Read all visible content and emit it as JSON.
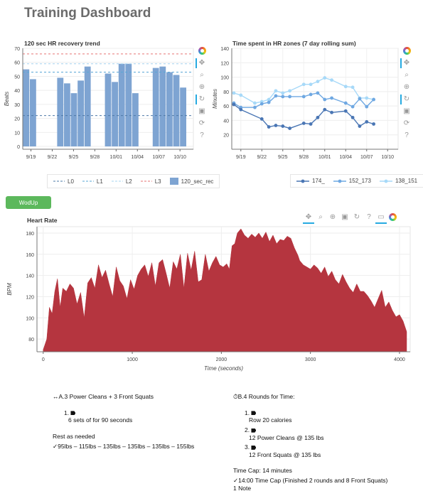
{
  "page": {
    "title": "Training Dashboard"
  },
  "charts_meta": {
    "hr_recovery": {
      "title": "120 sec HR recovery trend",
      "ylabel": "Beats"
    },
    "hr_zones": {
      "title": "Time spent in HR zones (7 day rolling sum)",
      "ylabel": "Minutes"
    },
    "heart_rate": {
      "title": "Heart Rate",
      "ylabel": "BPM",
      "xlabel": "Time (seconds)"
    }
  },
  "button": {
    "label": "WodUp"
  },
  "workout_a": {
    "header": "A.3 Power Cleans + 3 Front Squats",
    "items": [
      {
        "num": "1.",
        "text": "6 sets of for 90 seconds"
      }
    ],
    "rest": "Rest as needed",
    "result": "95lbs – 115lbs – 135lbs – 135lbs – 135lbs – 155lbs"
  },
  "workout_b": {
    "header": "B.4 Rounds for Time:",
    "items": [
      {
        "num": "1.",
        "text": "Row 20 calories"
      },
      {
        "num": "2.",
        "text": "12 Power Cleans @ 135 lbs"
      },
      {
        "num": "3.",
        "text": "12 Front Squats @ 135 lbs"
      }
    ],
    "time_cap": "Time Cap: 14 minutes",
    "result": "14:00 Time Cap (Finished 2 rounds and 8 Front Squats)",
    "note": "1 Note"
  },
  "chart_data": [
    {
      "type": "bar",
      "title": "120 sec HR recovery trend",
      "ylabel": "Beats",
      "x_ticks": [
        "9/19",
        "9/22",
        "9/25",
        "9/28",
        "10/01",
        "10/04",
        "10/07",
        "10/10"
      ],
      "ylim": [
        -2,
        70
      ],
      "y_ticks": [
        0,
        10,
        20,
        30,
        40,
        50,
        60,
        70
      ],
      "x_start_day": 0,
      "x_end_day": 24,
      "bars": [
        {
          "day": 0,
          "value": 55
        },
        {
          "day": 1,
          "value": 48
        },
        {
          "day": 5,
          "value": 49
        },
        {
          "day": 6,
          "value": 45
        },
        {
          "day": 7,
          "value": 38
        },
        {
          "day": 8,
          "value": 47
        },
        {
          "day": 9,
          "value": 57
        },
        {
          "day": 12,
          "value": 52
        },
        {
          "day": 13,
          "value": 46
        },
        {
          "day": 14,
          "value": 59
        },
        {
          "day": 15,
          "value": 59
        },
        {
          "day": 16,
          "value": 38
        },
        {
          "day": 19,
          "value": 56
        },
        {
          "day": 20,
          "value": 57
        },
        {
          "day": 21,
          "value": 53
        },
        {
          "day": 22,
          "value": 51
        },
        {
          "day": 23,
          "value": 42
        }
      ],
      "lines": [
        {
          "name": "L0",
          "value": 22,
          "color": "#4e79a7"
        },
        {
          "name": "L1",
          "value": 53,
          "color": "#5aa7d6"
        },
        {
          "name": "L2",
          "value": 59,
          "color": "#a5d4f0"
        },
        {
          "name": "L3",
          "value": 66,
          "color": "#e77373"
        }
      ],
      "bar_series": {
        "name": "120_sec_rec",
        "color": "#7ea4d2"
      }
    },
    {
      "type": "line",
      "title": "Time spent in HR zones (7 day rolling sum)",
      "ylabel": "Minutes",
      "x_ticks": [
        "9/19",
        "9/22",
        "9/25",
        "9/28",
        "10/01",
        "10/04",
        "10/07",
        "10/10"
      ],
      "ylim": [
        0,
        140
      ],
      "y_ticks": [
        20,
        40,
        60,
        80,
        100,
        120,
        140
      ],
      "series": [
        {
          "name": "174_",
          "color": "#4a76b4",
          "points": [
            [
              -1,
              62
            ],
            [
              0,
              55
            ],
            [
              3,
              42
            ],
            [
              4,
              31
            ],
            [
              5,
              33
            ],
            [
              6,
              32
            ],
            [
              7,
              29
            ],
            [
              9,
              36
            ],
            [
              10,
              35
            ],
            [
              11,
              44
            ],
            [
              12,
              55
            ],
            [
              13,
              51
            ],
            [
              15,
              53
            ],
            [
              16,
              44
            ],
            [
              17,
              32
            ],
            [
              18,
              38
            ],
            [
              19,
              35
            ]
          ]
        },
        {
          "name": "152_173",
          "color": "#6fa8e2",
          "points": [
            [
              -1,
              64
            ],
            [
              0,
              58
            ],
            [
              2,
              58
            ],
            [
              3,
              63
            ],
            [
              4,
              65
            ],
            [
              5,
              74
            ],
            [
              6,
              73
            ],
            [
              7,
              73
            ],
            [
              9,
              73
            ],
            [
              10,
              76
            ],
            [
              11,
              78
            ],
            [
              12,
              69
            ],
            [
              13,
              71
            ],
            [
              15,
              64
            ],
            [
              16,
              59
            ],
            [
              17,
              70
            ],
            [
              18,
              59
            ],
            [
              19,
              69
            ]
          ]
        },
        {
          "name": "138_151",
          "color": "#a7d9f8",
          "points": [
            [
              -1,
              78
            ],
            [
              0,
              75
            ],
            [
              2,
              64
            ],
            [
              3,
              66
            ],
            [
              4,
              69
            ],
            [
              5,
              81
            ],
            [
              6,
              78
            ],
            [
              7,
              81
            ],
            [
              9,
              90
            ],
            [
              10,
              90
            ],
            [
              11,
              94
            ],
            [
              12,
              99
            ],
            [
              13,
              96
            ],
            [
              15,
              87
            ],
            [
              16,
              86
            ],
            [
              17,
              71
            ],
            [
              18,
              71
            ],
            [
              19,
              69
            ]
          ]
        }
      ]
    },
    {
      "type": "area",
      "title": "Heart Rate",
      "xlabel": "Time (seconds)",
      "ylabel": "BPM",
      "xlim": [
        -70,
        4120
      ],
      "ylim": [
        68,
        186
      ],
      "x_ticks": [
        0,
        1000,
        2000,
        3000,
        4000
      ],
      "y_ticks": [
        80,
        100,
        120,
        140,
        160,
        180
      ],
      "color": "#b5353f",
      "x": [
        0,
        40,
        70,
        100,
        130,
        160,
        190,
        220,
        260,
        300,
        340,
        380,
        420,
        460,
        500,
        540,
        580,
        620,
        660,
        700,
        740,
        780,
        820,
        860,
        900,
        940,
        980,
        1020,
        1060,
        1100,
        1140,
        1180,
        1220,
        1260,
        1300,
        1340,
        1380,
        1420,
        1460,
        1500,
        1540,
        1580,
        1620,
        1660,
        1700,
        1740,
        1780,
        1820,
        1860,
        1900,
        1940,
        1980,
        2020,
        2060,
        2090,
        2120,
        2150,
        2180,
        2220,
        2260,
        2300,
        2340,
        2380,
        2420,
        2460,
        2500,
        2540,
        2580,
        2620,
        2660,
        2700,
        2740,
        2780,
        2820,
        2860,
        2880,
        2920,
        2960,
        3000,
        3040,
        3080,
        3120,
        3160,
        3200,
        3240,
        3280,
        3320,
        3360,
        3400,
        3440,
        3480,
        3520,
        3560,
        3600,
        3640,
        3680,
        3720,
        3760,
        3800,
        3840,
        3880,
        3920,
        3960,
        4000,
        4040,
        4080
      ],
      "y": [
        70,
        80,
        110,
        104,
        125,
        137,
        110,
        128,
        125,
        132,
        128,
        113,
        124,
        100,
        133,
        138,
        128,
        150,
        138,
        145,
        132,
        120,
        148,
        135,
        130,
        118,
        136,
        127,
        140,
        146,
        150,
        139,
        152,
        130,
        152,
        155,
        142,
        128,
        153,
        146,
        160,
        128,
        161,
        145,
        163,
        134,
        136,
        160,
        144,
        152,
        158,
        150,
        148,
        151,
        146,
        168,
        170,
        180,
        184,
        178,
        175,
        179,
        176,
        180,
        175,
        181,
        172,
        178,
        170,
        174,
        173,
        177,
        175,
        166,
        159,
        154,
        150,
        148,
        146,
        150,
        147,
        142,
        148,
        139,
        144,
        136,
        132,
        141,
        134,
        128,
        124,
        132,
        125,
        125,
        121,
        116,
        110,
        118,
        126,
        110,
        115,
        107,
        101,
        103,
        97,
        87
      ]
    }
  ]
}
